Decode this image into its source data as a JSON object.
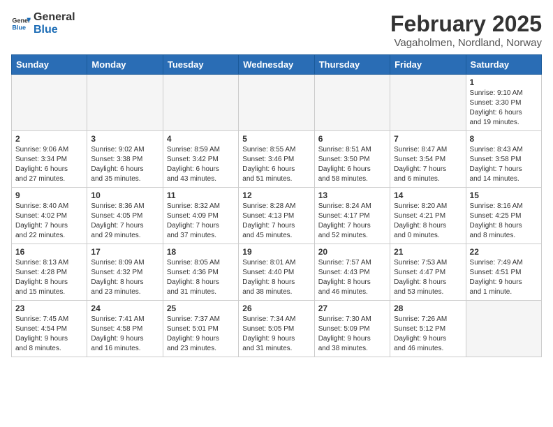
{
  "logo": {
    "general": "General",
    "blue": "Blue"
  },
  "title": "February 2025",
  "location": "Vagaholmen, Nordland, Norway",
  "days_of_week": [
    "Sunday",
    "Monday",
    "Tuesday",
    "Wednesday",
    "Thursday",
    "Friday",
    "Saturday"
  ],
  "weeks": [
    [
      {
        "day": "",
        "info": ""
      },
      {
        "day": "",
        "info": ""
      },
      {
        "day": "",
        "info": ""
      },
      {
        "day": "",
        "info": ""
      },
      {
        "day": "",
        "info": ""
      },
      {
        "day": "",
        "info": ""
      },
      {
        "day": "1",
        "info": "Sunrise: 9:10 AM\nSunset: 3:30 PM\nDaylight: 6 hours\nand 19 minutes."
      }
    ],
    [
      {
        "day": "2",
        "info": "Sunrise: 9:06 AM\nSunset: 3:34 PM\nDaylight: 6 hours\nand 27 minutes."
      },
      {
        "day": "3",
        "info": "Sunrise: 9:02 AM\nSunset: 3:38 PM\nDaylight: 6 hours\nand 35 minutes."
      },
      {
        "day": "4",
        "info": "Sunrise: 8:59 AM\nSunset: 3:42 PM\nDaylight: 6 hours\nand 43 minutes."
      },
      {
        "day": "5",
        "info": "Sunrise: 8:55 AM\nSunset: 3:46 PM\nDaylight: 6 hours\nand 51 minutes."
      },
      {
        "day": "6",
        "info": "Sunrise: 8:51 AM\nSunset: 3:50 PM\nDaylight: 6 hours\nand 58 minutes."
      },
      {
        "day": "7",
        "info": "Sunrise: 8:47 AM\nSunset: 3:54 PM\nDaylight: 7 hours\nand 6 minutes."
      },
      {
        "day": "8",
        "info": "Sunrise: 8:43 AM\nSunset: 3:58 PM\nDaylight: 7 hours\nand 14 minutes."
      }
    ],
    [
      {
        "day": "9",
        "info": "Sunrise: 8:40 AM\nSunset: 4:02 PM\nDaylight: 7 hours\nand 22 minutes."
      },
      {
        "day": "10",
        "info": "Sunrise: 8:36 AM\nSunset: 4:05 PM\nDaylight: 7 hours\nand 29 minutes."
      },
      {
        "day": "11",
        "info": "Sunrise: 8:32 AM\nSunset: 4:09 PM\nDaylight: 7 hours\nand 37 minutes."
      },
      {
        "day": "12",
        "info": "Sunrise: 8:28 AM\nSunset: 4:13 PM\nDaylight: 7 hours\nand 45 minutes."
      },
      {
        "day": "13",
        "info": "Sunrise: 8:24 AM\nSunset: 4:17 PM\nDaylight: 7 hours\nand 52 minutes."
      },
      {
        "day": "14",
        "info": "Sunrise: 8:20 AM\nSunset: 4:21 PM\nDaylight: 8 hours\nand 0 minutes."
      },
      {
        "day": "15",
        "info": "Sunrise: 8:16 AM\nSunset: 4:25 PM\nDaylight: 8 hours\nand 8 minutes."
      }
    ],
    [
      {
        "day": "16",
        "info": "Sunrise: 8:13 AM\nSunset: 4:28 PM\nDaylight: 8 hours\nand 15 minutes."
      },
      {
        "day": "17",
        "info": "Sunrise: 8:09 AM\nSunset: 4:32 PM\nDaylight: 8 hours\nand 23 minutes."
      },
      {
        "day": "18",
        "info": "Sunrise: 8:05 AM\nSunset: 4:36 PM\nDaylight: 8 hours\nand 31 minutes."
      },
      {
        "day": "19",
        "info": "Sunrise: 8:01 AM\nSunset: 4:40 PM\nDaylight: 8 hours\nand 38 minutes."
      },
      {
        "day": "20",
        "info": "Sunrise: 7:57 AM\nSunset: 4:43 PM\nDaylight: 8 hours\nand 46 minutes."
      },
      {
        "day": "21",
        "info": "Sunrise: 7:53 AM\nSunset: 4:47 PM\nDaylight: 8 hours\nand 53 minutes."
      },
      {
        "day": "22",
        "info": "Sunrise: 7:49 AM\nSunset: 4:51 PM\nDaylight: 9 hours\nand 1 minute."
      }
    ],
    [
      {
        "day": "23",
        "info": "Sunrise: 7:45 AM\nSunset: 4:54 PM\nDaylight: 9 hours\nand 8 minutes."
      },
      {
        "day": "24",
        "info": "Sunrise: 7:41 AM\nSunset: 4:58 PM\nDaylight: 9 hours\nand 16 minutes."
      },
      {
        "day": "25",
        "info": "Sunrise: 7:37 AM\nSunset: 5:01 PM\nDaylight: 9 hours\nand 23 minutes."
      },
      {
        "day": "26",
        "info": "Sunrise: 7:34 AM\nSunset: 5:05 PM\nDaylight: 9 hours\nand 31 minutes."
      },
      {
        "day": "27",
        "info": "Sunrise: 7:30 AM\nSunset: 5:09 PM\nDaylight: 9 hours\nand 38 minutes."
      },
      {
        "day": "28",
        "info": "Sunrise: 7:26 AM\nSunset: 5:12 PM\nDaylight: 9 hours\nand 46 minutes."
      },
      {
        "day": "",
        "info": ""
      }
    ]
  ]
}
